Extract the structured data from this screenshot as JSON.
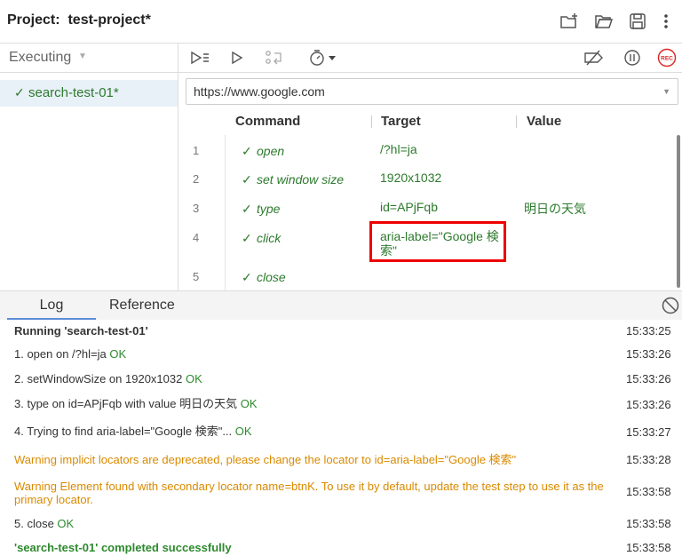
{
  "header": {
    "project_label": "Project:",
    "project_name": "test-project*"
  },
  "left_panel": {
    "section_label": "Executing",
    "test_name": "search-test-01*"
  },
  "url": {
    "value": "https://www.google.com"
  },
  "table": {
    "headers": {
      "command": "Command",
      "target": "Target",
      "value": "Value"
    },
    "rows": [
      {
        "num": "1",
        "command": "open",
        "target": "/?hl=ja",
        "value": ""
      },
      {
        "num": "2",
        "command": "set window size",
        "target": "1920x1032",
        "value": ""
      },
      {
        "num": "3",
        "command": "type",
        "target": "id=APjFqb",
        "value": "明日の天気"
      },
      {
        "num": "4",
        "command": "click",
        "target": "aria-label=\"Google 検索\"",
        "value": ""
      },
      {
        "num": "5",
        "command": "close",
        "target": "",
        "value": ""
      }
    ]
  },
  "tabs": {
    "log": "Log",
    "reference": "Reference"
  },
  "log": [
    {
      "text": "Running 'search-test-01'",
      "suffix": "",
      "time": "15:33:25"
    },
    {
      "text": "1.  open on /?hl=ja ",
      "suffix": "OK",
      "time": "15:33:26"
    },
    {
      "text": "2.  setWindowSize on 1920x1032 ",
      "suffix": "OK",
      "time": "15:33:26"
    },
    {
      "text": "3.  type on id=APjFqb with value 明日の天気 ",
      "suffix": "OK",
      "time": "15:33:26"
    },
    {
      "text": "4.  Trying to find aria-label=\"Google 検索\"... ",
      "suffix": "OK",
      "time": "15:33:27"
    },
    {
      "text": "Warning implicit locators are deprecated, please change the locator to id=aria-label=\"Google 検索\"",
      "suffix": "",
      "time": "15:33:28"
    },
    {
      "text": "Warning Element found with secondary locator name=btnK. To use it by default, update the test step to use it as the primary locator.",
      "suffix": "",
      "time": "15:33:58"
    },
    {
      "text": "5.  close ",
      "suffix": "OK",
      "time": "15:33:58"
    },
    {
      "text": "'search-test-01' completed successfully",
      "suffix": "",
      "time": "15:33:58"
    }
  ]
}
